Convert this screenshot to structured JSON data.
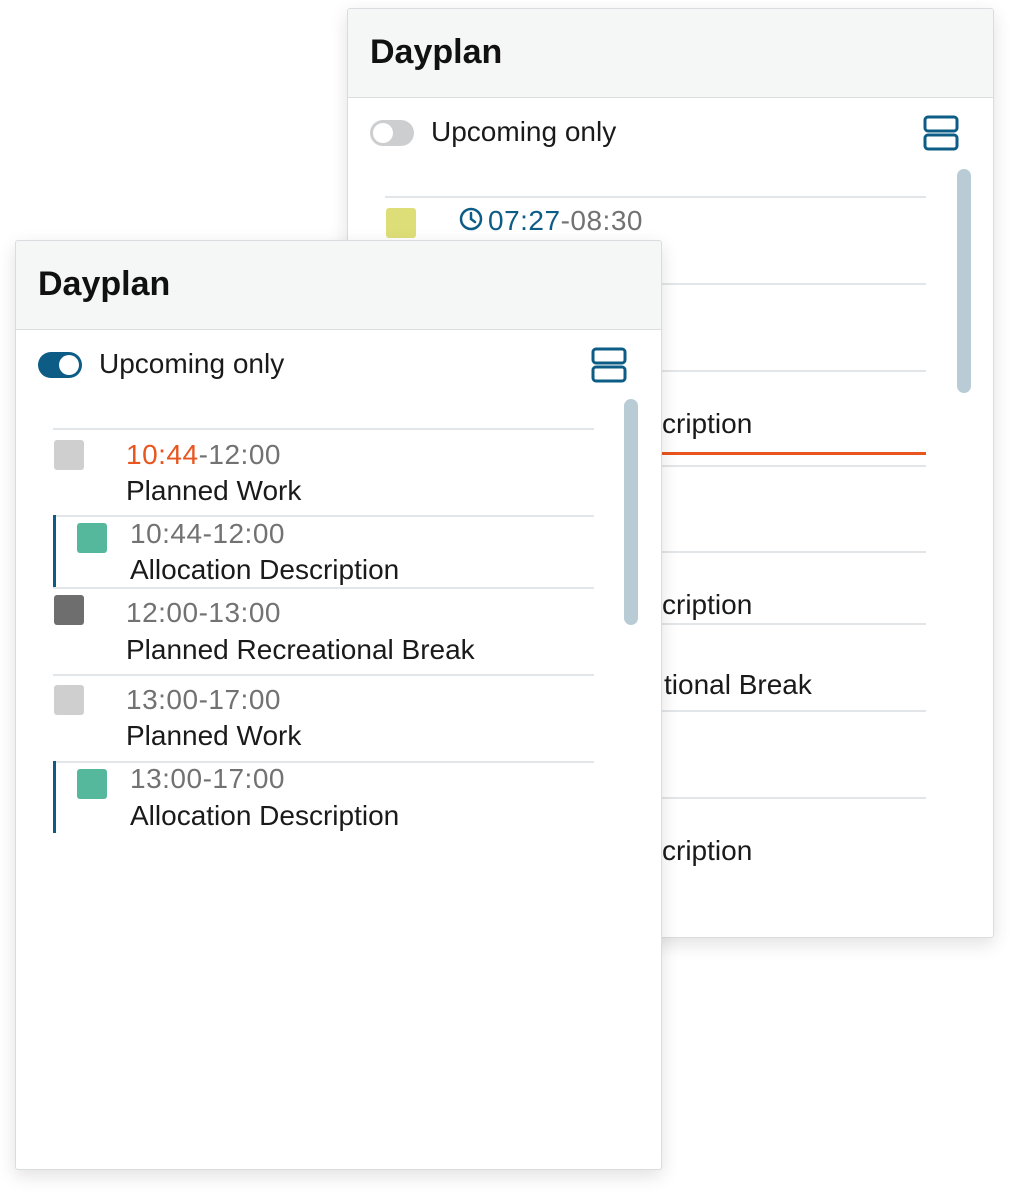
{
  "back_panel": {
    "title": "Dayplan",
    "toggle_label": "Upcoming only",
    "toggle_on": false,
    "first_entry": {
      "clock_icon": "clock-icon",
      "start": "07:27",
      "separator": "-",
      "end": "08:30"
    },
    "partial_texts": [
      "cription",
      "cription",
      "tional Break",
      "cription"
    ]
  },
  "front_panel": {
    "title": "Dayplan",
    "toggle_label": "Upcoming only",
    "toggle_on": true,
    "entries": [
      {
        "start": "10:44",
        "separator": "-",
        "end": "12:00",
        "label": "Planned Work",
        "swatch_color": "#cfcfcf",
        "is_sub": false,
        "start_is_now": true
      },
      {
        "time": "10:44-12:00",
        "label": "Allocation Description",
        "swatch_color": "#55b79b",
        "is_sub": true
      },
      {
        "time": "12:00-13:00",
        "label": "Planned Recreational Break",
        "swatch_color": "#6e6e6e",
        "is_sub": false
      },
      {
        "time": "13:00-17:00",
        "label": "Planned Work",
        "swatch_color": "#cfcfcf",
        "is_sub": false
      },
      {
        "time": "13:00-17:00",
        "label": "Allocation Description",
        "swatch_color": "#55b79b",
        "is_sub": true
      }
    ]
  },
  "colors": {
    "accent": "#0d5c86",
    "now_marker": "#e8551f",
    "yellow_swatch": "#dede78",
    "scrollbar": "#b9ccd6"
  }
}
